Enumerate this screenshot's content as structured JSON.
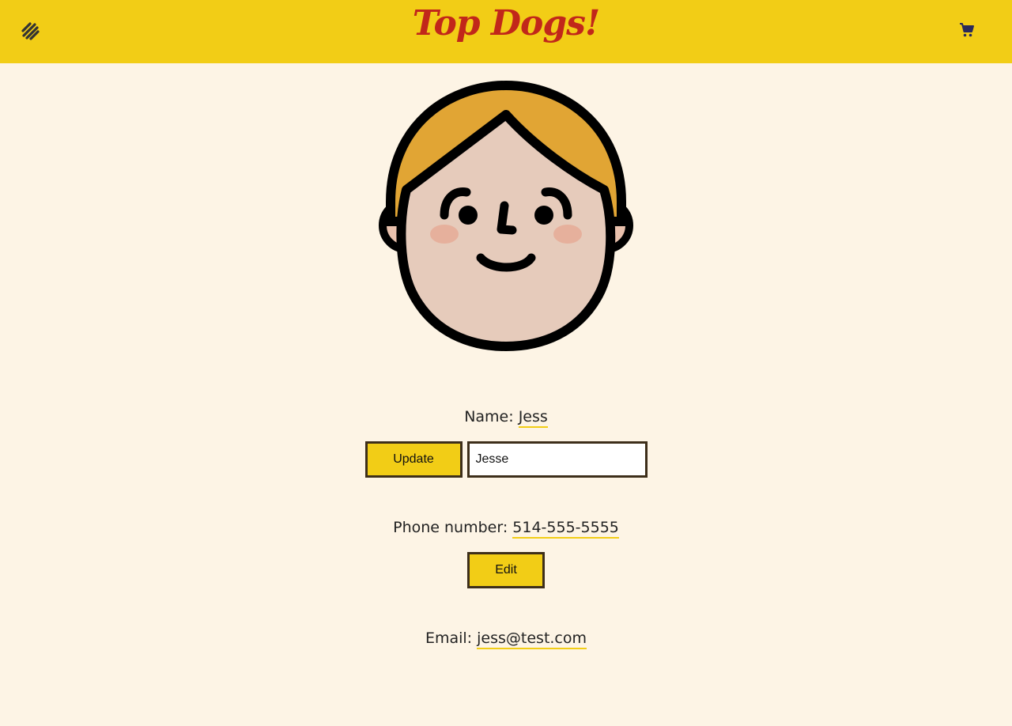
{
  "header": {
    "brand": "Top Dogs!",
    "menu_icon": "hotdog-menu-icon",
    "cart_icon": "shopping-cart-icon"
  },
  "colors": {
    "header_bg": "#f2cd16",
    "page_bg": "#fdf4e5",
    "brand_text": "#c1271a",
    "button_bg": "#f2cd16",
    "button_border": "#3d2e1a",
    "underline": "#f2cd16",
    "cart_icon": "#2a2a5a"
  },
  "avatar": {
    "icon": "user-face-avatar"
  },
  "profile": {
    "name": {
      "label": "Name:",
      "value": "Jess",
      "button_label": "Update",
      "input_value": "Jesse"
    },
    "phone": {
      "label": "Phone number:",
      "value": "514-555-5555",
      "button_label": "Edit"
    },
    "email": {
      "label": "Email:",
      "value": "jess@test.com"
    }
  }
}
